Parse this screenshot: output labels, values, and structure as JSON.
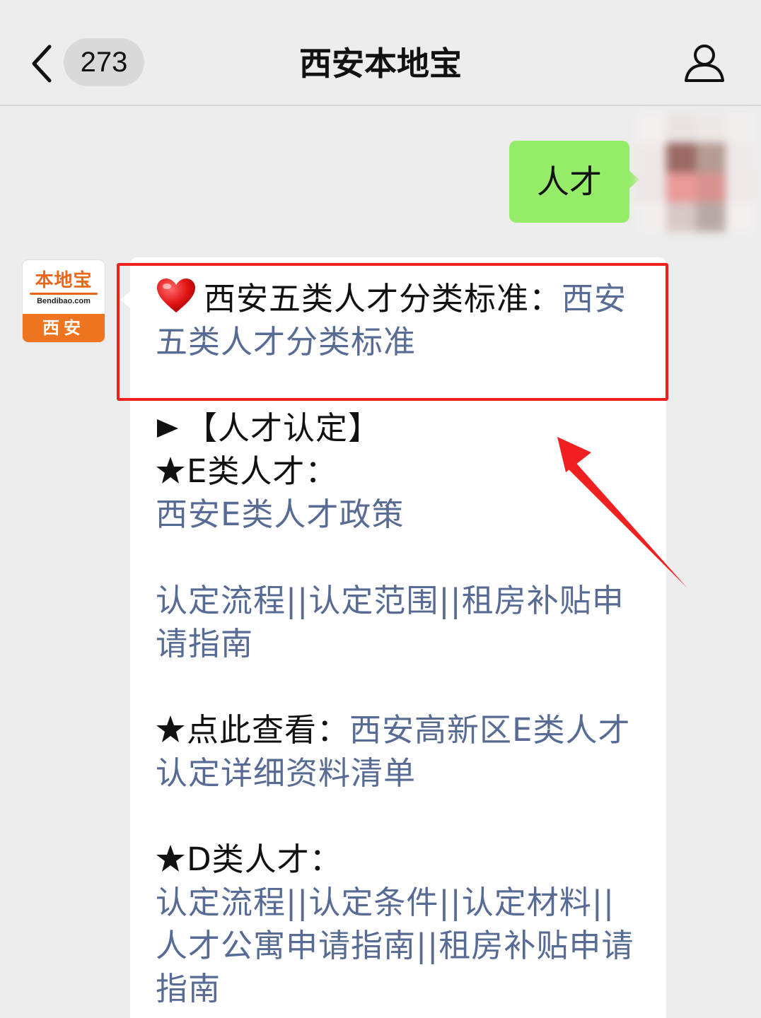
{
  "header": {
    "back_icon": "chevron-left-icon",
    "unread_count": "273",
    "title": "西安本地宝",
    "profile_icon": "person-icon"
  },
  "outgoing": {
    "text": "人才"
  },
  "bot": {
    "avatar": {
      "logo_text": "本地宝",
      "logo_domain": "Bendibao.com",
      "logo_city": "西安"
    }
  },
  "message": {
    "line1_prefix": "西安五类人才分类标准：",
    "line1_link": "西安五类人才分类标准",
    "section_heading": "【人才认定】",
    "e_class_label": "E类人才：",
    "e_policy_link": "西安E类人才政策",
    "e_links": [
      "认定流程",
      "认定范围",
      "租房补贴申请指南"
    ],
    "view_label": "点此查看：",
    "view_link": "西安高新区E类人才认定详细资料清单",
    "d_class_label": "D类人才：",
    "d_links": [
      "认定流程",
      "认定条件",
      "认定材料",
      "人才公寓申请指南",
      "租房补贴申请指南"
    ],
    "separator": "||"
  },
  "colors": {
    "link": "#576b95",
    "outgoing_bubble": "#95ec69",
    "highlight": "#f02020",
    "background": "#ededed"
  }
}
